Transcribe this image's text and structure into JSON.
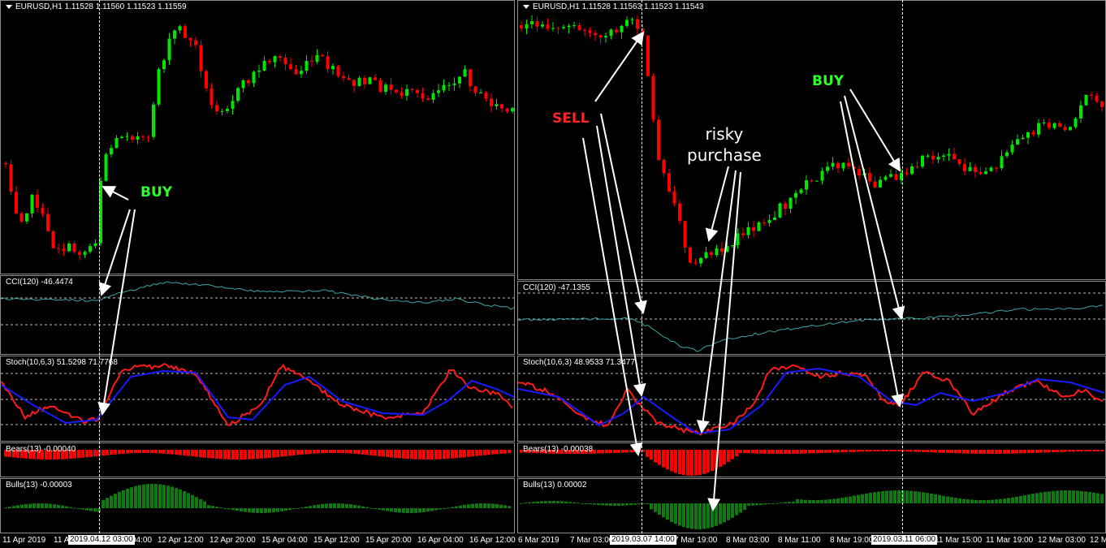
{
  "left_chart": {
    "symbol": "EURUSD,H1",
    "ohlc": "1.11528 1.11560 1.11523 1.11559",
    "cci_label": "CCI(120) -46.4474",
    "stoch_label": "Stoch(10,6,3) 51.5298 71.7768",
    "bears_label": "Bears(13) -0.00040",
    "bulls_label": "Bulls(13) -0.00003",
    "annotations": {
      "buy": "BUY"
    },
    "cursor_time": "2019.04.12 03:00",
    "time_axis": [
      "11 Apr 2019",
      "11 A",
      "04:00",
      "12 Apr 12:00",
      "12 Apr 20:00",
      "15 Apr 04:00",
      "15 Apr 12:00",
      "15 Apr 20:00",
      "16 Apr 04:00",
      "16 Apr 12:00"
    ]
  },
  "right_chart": {
    "symbol": "EURUSD,H1",
    "ohlc": "1.11528 1.11563 1.11523 1.11543",
    "cci_label": "CCI(120) -47.1355",
    "stoch_label": "Stoch(10,6,3) 48.9533 71.3477",
    "bears_label": "Bears(13) -0.00038",
    "bulls_label": "Bulls(13) 0.00002",
    "annotations": {
      "sell": "SELL",
      "risky_line1": "risky",
      "risky_line2": "purchase",
      "buy": "BUY"
    },
    "cursor_time_1": "2019.03.07 14:00",
    "cursor_time_2": "2019.03.11 06:00",
    "time_axis": [
      "6 Mar 2019",
      "7 Mar 03:00",
      "7 Mar 19:00",
      "8 Mar 03:00",
      "8 Mar 11:00",
      "8 Mar 19:00",
      "11 Mar 15:00",
      "11 Mar 19:00",
      "12 Mar 03:00",
      "12 M"
    ]
  },
  "colors": {
    "bull_candle": "#00e600",
    "bear_candle": "#ff0000",
    "cci_line": "#3aa6a6",
    "stoch_main": "#ff1a1a",
    "stoch_signal": "#1a1aff",
    "bears_hist": "#ff0000",
    "bulls_hist": "#0f7a0f",
    "arrow": "#ffffff"
  }
}
